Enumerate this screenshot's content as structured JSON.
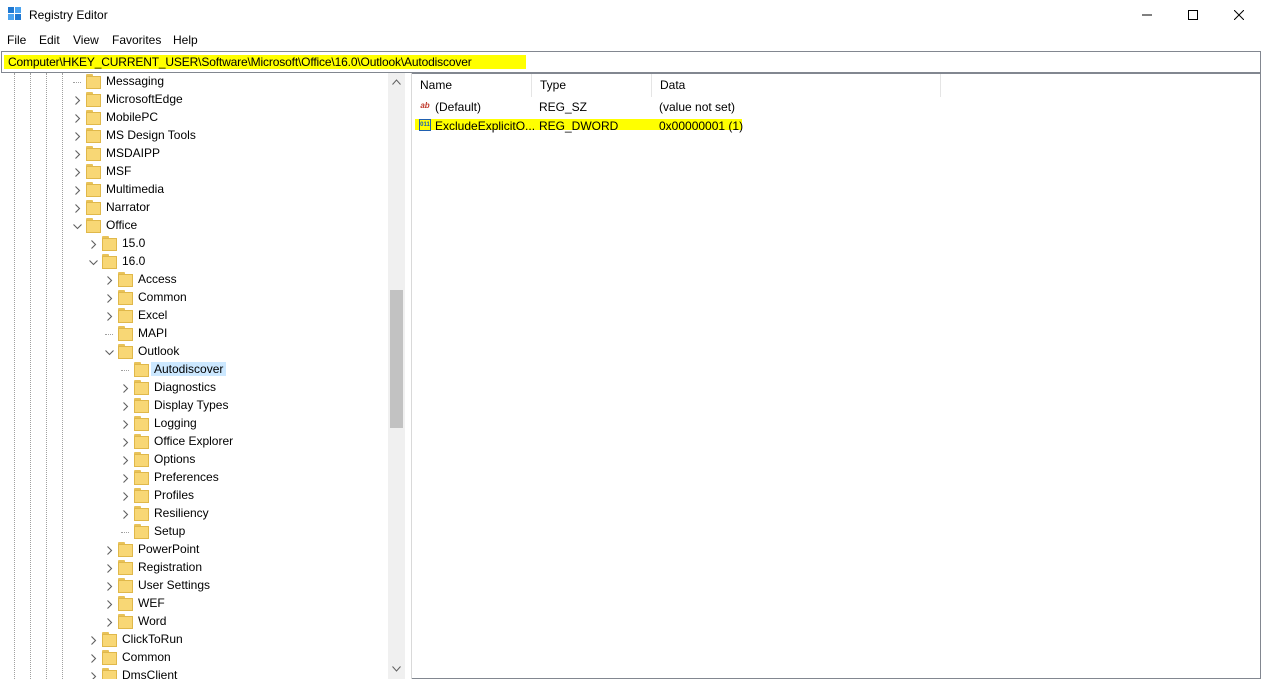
{
  "window": {
    "title": "Registry Editor",
    "icon": "registry-editor-icon"
  },
  "window_controls": {
    "minimize": "—",
    "maximize": "☐",
    "close": "✕"
  },
  "menu": [
    "File",
    "Edit",
    "View",
    "Favorites",
    "Help"
  ],
  "address": {
    "path": "Computer\\HKEY_CURRENT_USER\\Software\\Microsoft\\Office\\16.0\\Outlook\\Autodiscover",
    "highlight_color": "#ffff00"
  },
  "tree": [
    {
      "label": "Messaging",
      "depth": 0,
      "expander": "none"
    },
    {
      "label": "MicrosoftEdge",
      "depth": 0,
      "expander": "collapsed"
    },
    {
      "label": "MobilePC",
      "depth": 0,
      "expander": "collapsed"
    },
    {
      "label": "MS Design Tools",
      "depth": 0,
      "expander": "collapsed"
    },
    {
      "label": "MSDAIPP",
      "depth": 0,
      "expander": "collapsed"
    },
    {
      "label": "MSF",
      "depth": 0,
      "expander": "collapsed"
    },
    {
      "label": "Multimedia",
      "depth": 0,
      "expander": "collapsed"
    },
    {
      "label": "Narrator",
      "depth": 0,
      "expander": "collapsed"
    },
    {
      "label": "Office",
      "depth": 0,
      "expander": "expanded"
    },
    {
      "label": "15.0",
      "depth": 1,
      "expander": "collapsed"
    },
    {
      "label": "16.0",
      "depth": 1,
      "expander": "expanded"
    },
    {
      "label": "Access",
      "depth": 2,
      "expander": "collapsed"
    },
    {
      "label": "Common",
      "depth": 2,
      "expander": "collapsed"
    },
    {
      "label": "Excel",
      "depth": 2,
      "expander": "collapsed"
    },
    {
      "label": "MAPI",
      "depth": 2,
      "expander": "none"
    },
    {
      "label": "Outlook",
      "depth": 2,
      "expander": "expanded"
    },
    {
      "label": "Autodiscover",
      "depth": 3,
      "expander": "none",
      "selected": true
    },
    {
      "label": "Diagnostics",
      "depth": 3,
      "expander": "collapsed"
    },
    {
      "label": "Display Types",
      "depth": 3,
      "expander": "collapsed"
    },
    {
      "label": "Logging",
      "depth": 3,
      "expander": "collapsed"
    },
    {
      "label": "Office Explorer",
      "depth": 3,
      "expander": "collapsed"
    },
    {
      "label": "Options",
      "depth": 3,
      "expander": "collapsed"
    },
    {
      "label": "Preferences",
      "depth": 3,
      "expander": "collapsed"
    },
    {
      "label": "Profiles",
      "depth": 3,
      "expander": "collapsed"
    },
    {
      "label": "Resiliency",
      "depth": 3,
      "expander": "collapsed"
    },
    {
      "label": "Setup",
      "depth": 3,
      "expander": "none"
    },
    {
      "label": "PowerPoint",
      "depth": 2,
      "expander": "collapsed"
    },
    {
      "label": "Registration",
      "depth": 2,
      "expander": "collapsed"
    },
    {
      "label": "User Settings",
      "depth": 2,
      "expander": "collapsed"
    },
    {
      "label": "WEF",
      "depth": 2,
      "expander": "collapsed"
    },
    {
      "label": "Word",
      "depth": 2,
      "expander": "collapsed"
    },
    {
      "label": "ClickToRun",
      "depth": 1,
      "expander": "collapsed"
    },
    {
      "label": "Common",
      "depth": 1,
      "expander": "collapsed"
    },
    {
      "label": "DmsClient",
      "depth": 1,
      "expander": "collapsed"
    }
  ],
  "values_table": {
    "columns": [
      "Name",
      "Type",
      "Data"
    ],
    "rows": [
      {
        "icon": "string-value-icon",
        "icon_text": "ab",
        "name": "(Default)",
        "type": "REG_SZ",
        "data": "(value not set)"
      },
      {
        "icon": "binary-value-icon",
        "icon_text": "011",
        "name": "ExcludeExplicitO...",
        "type": "REG_DWORD",
        "data": "0x00000001 (1)",
        "highlighted": true
      }
    ]
  },
  "colors": {
    "selection": "#cce8ff",
    "highlight": "#ffff00",
    "folder": "#f8d775"
  }
}
